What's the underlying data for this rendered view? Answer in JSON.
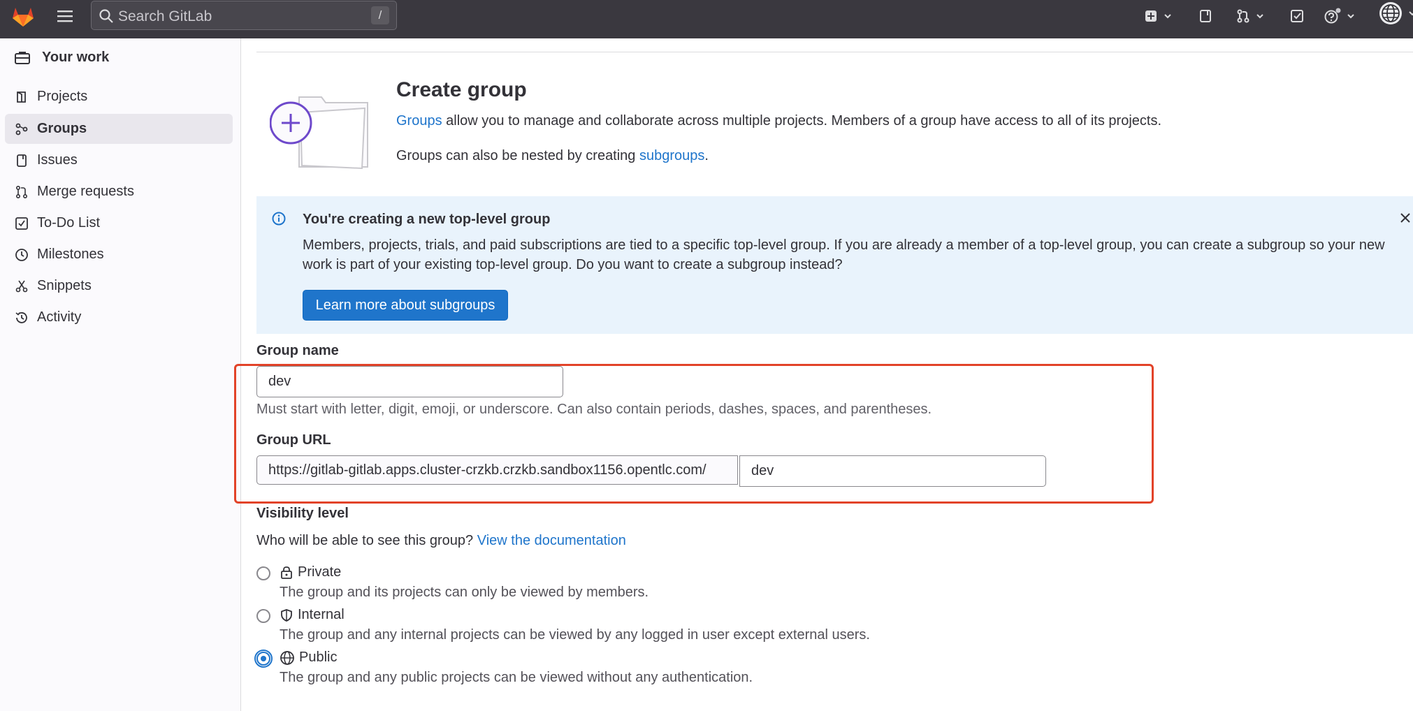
{
  "topbar": {
    "search_placeholder": "Search GitLab",
    "search_shortcut": "/"
  },
  "sidebar": {
    "context": "Your work",
    "items": [
      {
        "label": "Projects",
        "icon": "project-icon"
      },
      {
        "label": "Groups",
        "icon": "group-icon",
        "active": true
      },
      {
        "label": "Issues",
        "icon": "issues-icon"
      },
      {
        "label": "Merge requests",
        "icon": "merge-request-icon"
      },
      {
        "label": "To-Do List",
        "icon": "todo-icon"
      },
      {
        "label": "Milestones",
        "icon": "clock-icon"
      },
      {
        "label": "Snippets",
        "icon": "scissors-icon"
      },
      {
        "label": "Activity",
        "icon": "history-icon"
      }
    ]
  },
  "header": {
    "title": "Create group",
    "intro_link": "Groups",
    "intro_rest": " allow you to manage and collaborate across multiple projects. Members of a group have access to all of its projects.",
    "nested_prefix": "Groups can also be nested by creating ",
    "nested_link": "subgroups",
    "nested_suffix": "."
  },
  "alert": {
    "title": "You're creating a new top-level group",
    "body": "Members, projects, trials, and paid subscriptions are tied to a specific top-level group. If you are already a member of a top-level group, you can create a subgroup so your new work is part of your existing top-level group. Do you want to create a subgroup instead?",
    "button": "Learn more about subgroups"
  },
  "form": {
    "group_name_label": "Group name",
    "group_name_value": "dev",
    "group_name_help": "Must start with letter, digit, emoji, or underscore. Can also contain periods, dashes, spaces, and parentheses.",
    "group_url_label": "Group URL",
    "group_url_prefix": "https://gitlab-gitlab.apps.cluster-crzkb.crzkb.sandbox1156.opentlc.com/",
    "group_url_value": "dev",
    "visibility_label": "Visibility level",
    "visibility_question": "Who will be able to see this group? ",
    "visibility_doc_link": "View the documentation",
    "options": [
      {
        "label": "Private",
        "desc": "The group and its projects can only be viewed by members.",
        "checked": false
      },
      {
        "label": "Internal",
        "desc": "The group and any internal projects can be viewed by any logged in user except external users.",
        "checked": false
      },
      {
        "label": "Public",
        "desc": "The group and any public projects can be viewed without any authentication.",
        "checked": true
      }
    ]
  },
  "colors": {
    "topbar": "#3a383f",
    "link": "#1f75cb",
    "alert_bg": "#e9f3fc",
    "highlight": "#e24329",
    "illustration_accent": "#6e49cb"
  }
}
